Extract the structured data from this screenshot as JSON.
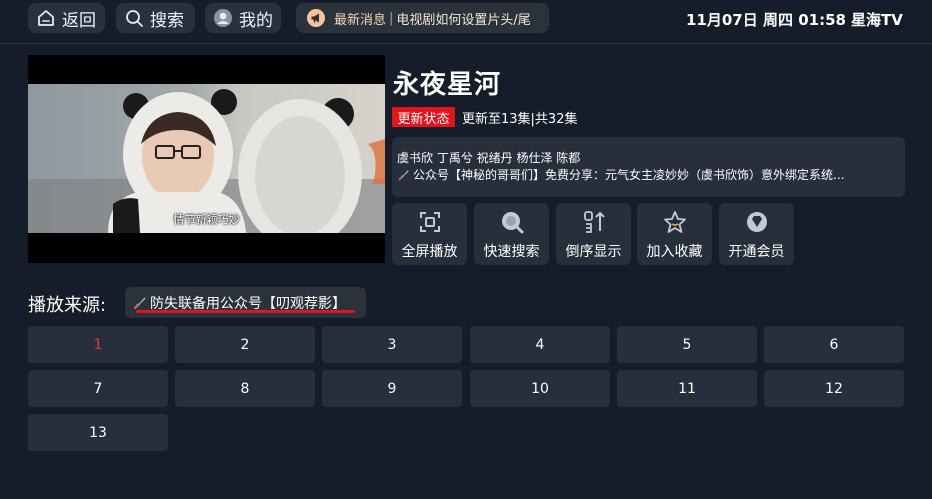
{
  "header": {
    "back_label": "返回",
    "search_label": "搜索",
    "profile_label": "我的",
    "news_label": "最新消息",
    "news_separator": "|",
    "news_text": "电视剧如何设置片头/尾",
    "datetime": "11月07日 周四 01:58",
    "brand": "星海TV"
  },
  "player": {
    "subtitle": "情节新颖巧妙"
  },
  "show": {
    "title": "永夜星河",
    "status_badge": "更新状态",
    "update_text": "更新至13集|共32集",
    "cast": "虞书欣 丁禹兮 祝绪丹 杨仕泽 陈都",
    "promo": "公众号【神秘的哥哥们】免费分享：元气女主凌妙妙（虞书欣饰）意外绑定系统..."
  },
  "actions": [
    {
      "label": "全屏播放",
      "icon": "fullscreen-icon"
    },
    {
      "label": "快速搜索",
      "icon": "search-icon"
    },
    {
      "label": "倒序显示",
      "icon": "sort-icon"
    },
    {
      "label": "加入收藏",
      "icon": "star-icon"
    },
    {
      "label": "开通会员",
      "icon": "vip-diamond-icon"
    }
  ],
  "source": {
    "label": "播放来源:",
    "selected": "防失联备用公众号【叨观荐影】"
  },
  "episodes": [
    "1",
    "2",
    "3",
    "4",
    "5",
    "6",
    "7",
    "8",
    "9",
    "10",
    "11",
    "12",
    "13"
  ],
  "colors": {
    "background": "#141d29",
    "accent_red": "#e3141b",
    "tile": "#262f3b",
    "active_episode": "#e03a3a"
  }
}
